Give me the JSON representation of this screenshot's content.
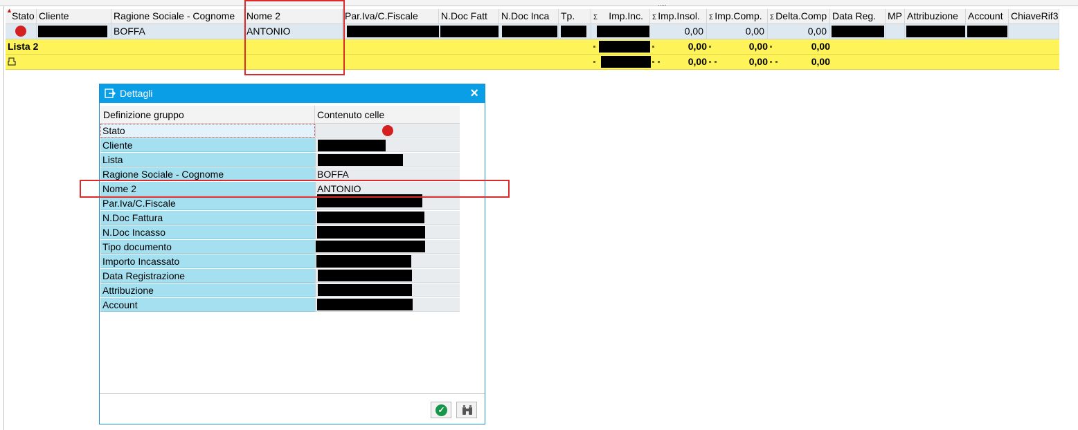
{
  "grid": {
    "columns": [
      "Stato",
      "Cliente",
      "Ragione Sociale - Cognome",
      "Nome 2",
      "Par.Iva/C.Fiscale",
      "N.Doc Fatt",
      "N.Doc Inca",
      "Tp.",
      "",
      "Imp.Inc.",
      "Imp.Insol.",
      "Imp.Comp.",
      "Delta.Comp",
      "Data Reg.",
      "MP",
      "Attribuzione",
      "Account",
      "ChiaveRif3"
    ],
    "sigma": "Σ",
    "row": {
      "ragione_sociale": "BOFFA",
      "nome2": "ANTONIO",
      "imp_insol": "0,00",
      "imp_comp": "0,00",
      "delta_comp": "0,00",
      "status_color": "#d42020"
    },
    "subtotal": {
      "label": "Lista 2",
      "imp_insol": "0,00",
      "imp_comp": "0,00",
      "delta_comp": "0,00"
    },
    "total": {
      "icon": "total-sum-icon",
      "imp_insol": "0,00",
      "imp_comp": "0,00",
      "delta_comp": "0,00"
    }
  },
  "dialog": {
    "title": "Dettagli",
    "icon": "details-icon",
    "header_definition": "Definizione gruppo",
    "header_content": "Contenuto celle",
    "rows": [
      {
        "label": "Stato"
      },
      {
        "label": "Cliente"
      },
      {
        "label": "Lista"
      },
      {
        "label": "Ragione Sociale - Cognome",
        "value": "BOFFA"
      },
      {
        "label": "Nome 2",
        "value": "ANTONIO"
      },
      {
        "label": "Par.Iva/C.Fiscale"
      },
      {
        "label": "N.Doc Fattura"
      },
      {
        "label": "N.Doc Incasso"
      },
      {
        "label": "Tipo documento"
      },
      {
        "label": "Importo Incassato"
      },
      {
        "label": "Data Registrazione"
      },
      {
        "label": "Attribuzione"
      },
      {
        "label": "Account"
      }
    ],
    "buttons": {
      "ok_icon": "checkmark-icon",
      "find_icon": "binoculars-icon"
    }
  },
  "colors": {
    "header_bg": "#f2f2f2",
    "row_bg": "#dde8f1",
    "subtotal_bg": "#fef45a",
    "dialog_title_bg": "#0a9ee6",
    "label_bg": "#a5e0f1",
    "highlight": "#dc2a2a"
  }
}
